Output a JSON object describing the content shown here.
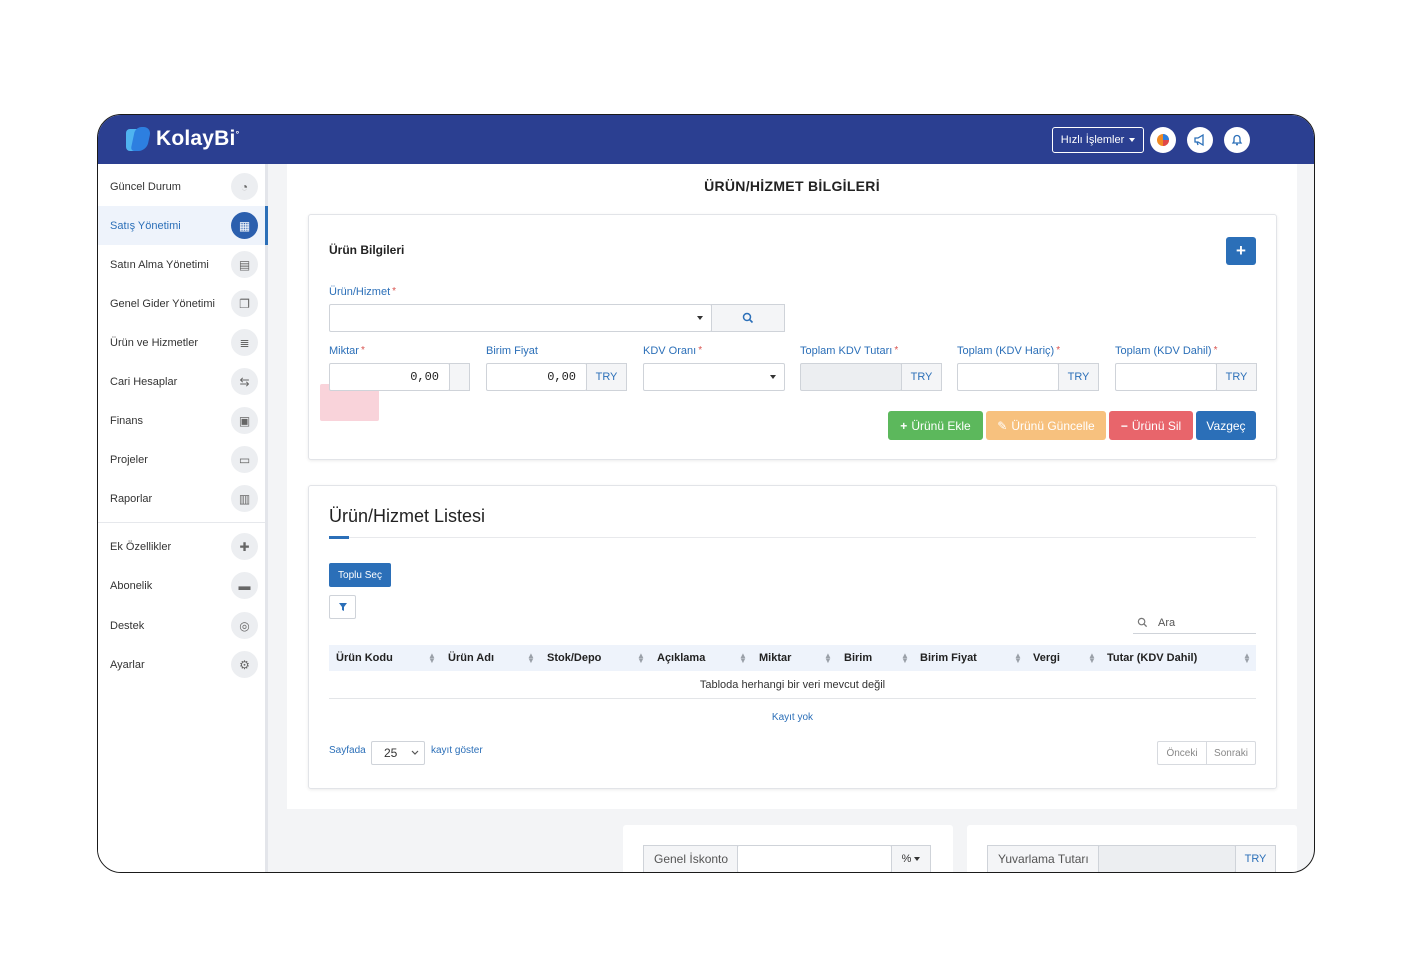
{
  "header": {
    "brand": "KolayBi",
    "brand_mark": "°",
    "quick_actions": "Hızlı İşlemler",
    "icons": [
      "color-wheel-icon",
      "megaphone-icon",
      "bell-icon"
    ]
  },
  "sidebar": {
    "items": [
      {
        "label": "Güncel Durum",
        "icon": "dashboard-icon"
      },
      {
        "label": "Satış Yönetimi",
        "icon": "calculator-icon",
        "active": true
      },
      {
        "label": "Satın Alma Yönetimi",
        "icon": "document-icon"
      },
      {
        "label": "Genel Gider Yönetimi",
        "icon": "copy-icon"
      },
      {
        "label": "Ürün ve Hizmetler",
        "icon": "database-icon"
      },
      {
        "label": "Cari Hesaplar",
        "icon": "handshake-icon"
      },
      {
        "label": "Finans",
        "icon": "money-icon"
      },
      {
        "label": "Projeler",
        "icon": "folder-icon"
      },
      {
        "label": "Raporlar",
        "icon": "bar-chart-icon"
      },
      {
        "label": "Ek Özellikler",
        "icon": "puzzle-icon"
      },
      {
        "label": "Abonelik",
        "icon": "credit-card-icon"
      },
      {
        "label": "Destek",
        "icon": "lifebuoy-icon"
      },
      {
        "label": "Ayarlar",
        "icon": "gears-icon"
      }
    ]
  },
  "page": {
    "title": "ÜRÜN/HİZMET BİLGİLERİ"
  },
  "form": {
    "section_title": "Ürün Bilgileri",
    "add_button": "+",
    "product_label": "Ürün/Hizmet",
    "required_mark": "*",
    "quantity_label": "Miktar",
    "quantity_value": "0,00",
    "unit_price_label": "Birim Fiyat",
    "unit_price_value": "0,00",
    "currency": "TRY",
    "vat_rate_label": "KDV Oranı",
    "total_vat_label": "Toplam KDV Tutarı",
    "total_excl_label": "Toplam (KDV Hariç)",
    "total_incl_label": "Toplam (KDV Dahil)",
    "buttons": {
      "add": "Ürünü Ekle",
      "update": "Ürünü Güncelle",
      "delete": "Ürünü Sil",
      "cancel": "Vazgeç"
    },
    "colors": {
      "add": "#5cb85c",
      "update": "#f7c17e",
      "delete": "#e8656b",
      "cancel": "#2b6fb8"
    }
  },
  "list": {
    "title": "Ürün/Hizmet Listesi",
    "bulk_select": "Toplu Seç",
    "search_placeholder": "Ara",
    "columns": [
      "Ürün Kodu",
      "Ürün Adı",
      "Stok/Depo",
      "Açıklama",
      "Miktar",
      "Birim",
      "Birim Fiyat",
      "Vergi",
      "Tutar (KDV Dahil)"
    ],
    "empty_message": "Tabloda herhangi bir veri mevcut değil",
    "no_records": "Kayıt yok",
    "per_page_prefix": "Sayfada",
    "per_page_value": "25",
    "per_page_suffix": "kayıt göster",
    "prev": "Önceki",
    "next": "Sonraki"
  },
  "summary": {
    "discount_label": "Genel İskonto",
    "discount_unit": "%",
    "rounding_label": "Yuvarlama Tutarı",
    "currency": "TRY"
  },
  "theme": {
    "header_bg": "#2b3f91",
    "accent": "#2b6fb8"
  }
}
